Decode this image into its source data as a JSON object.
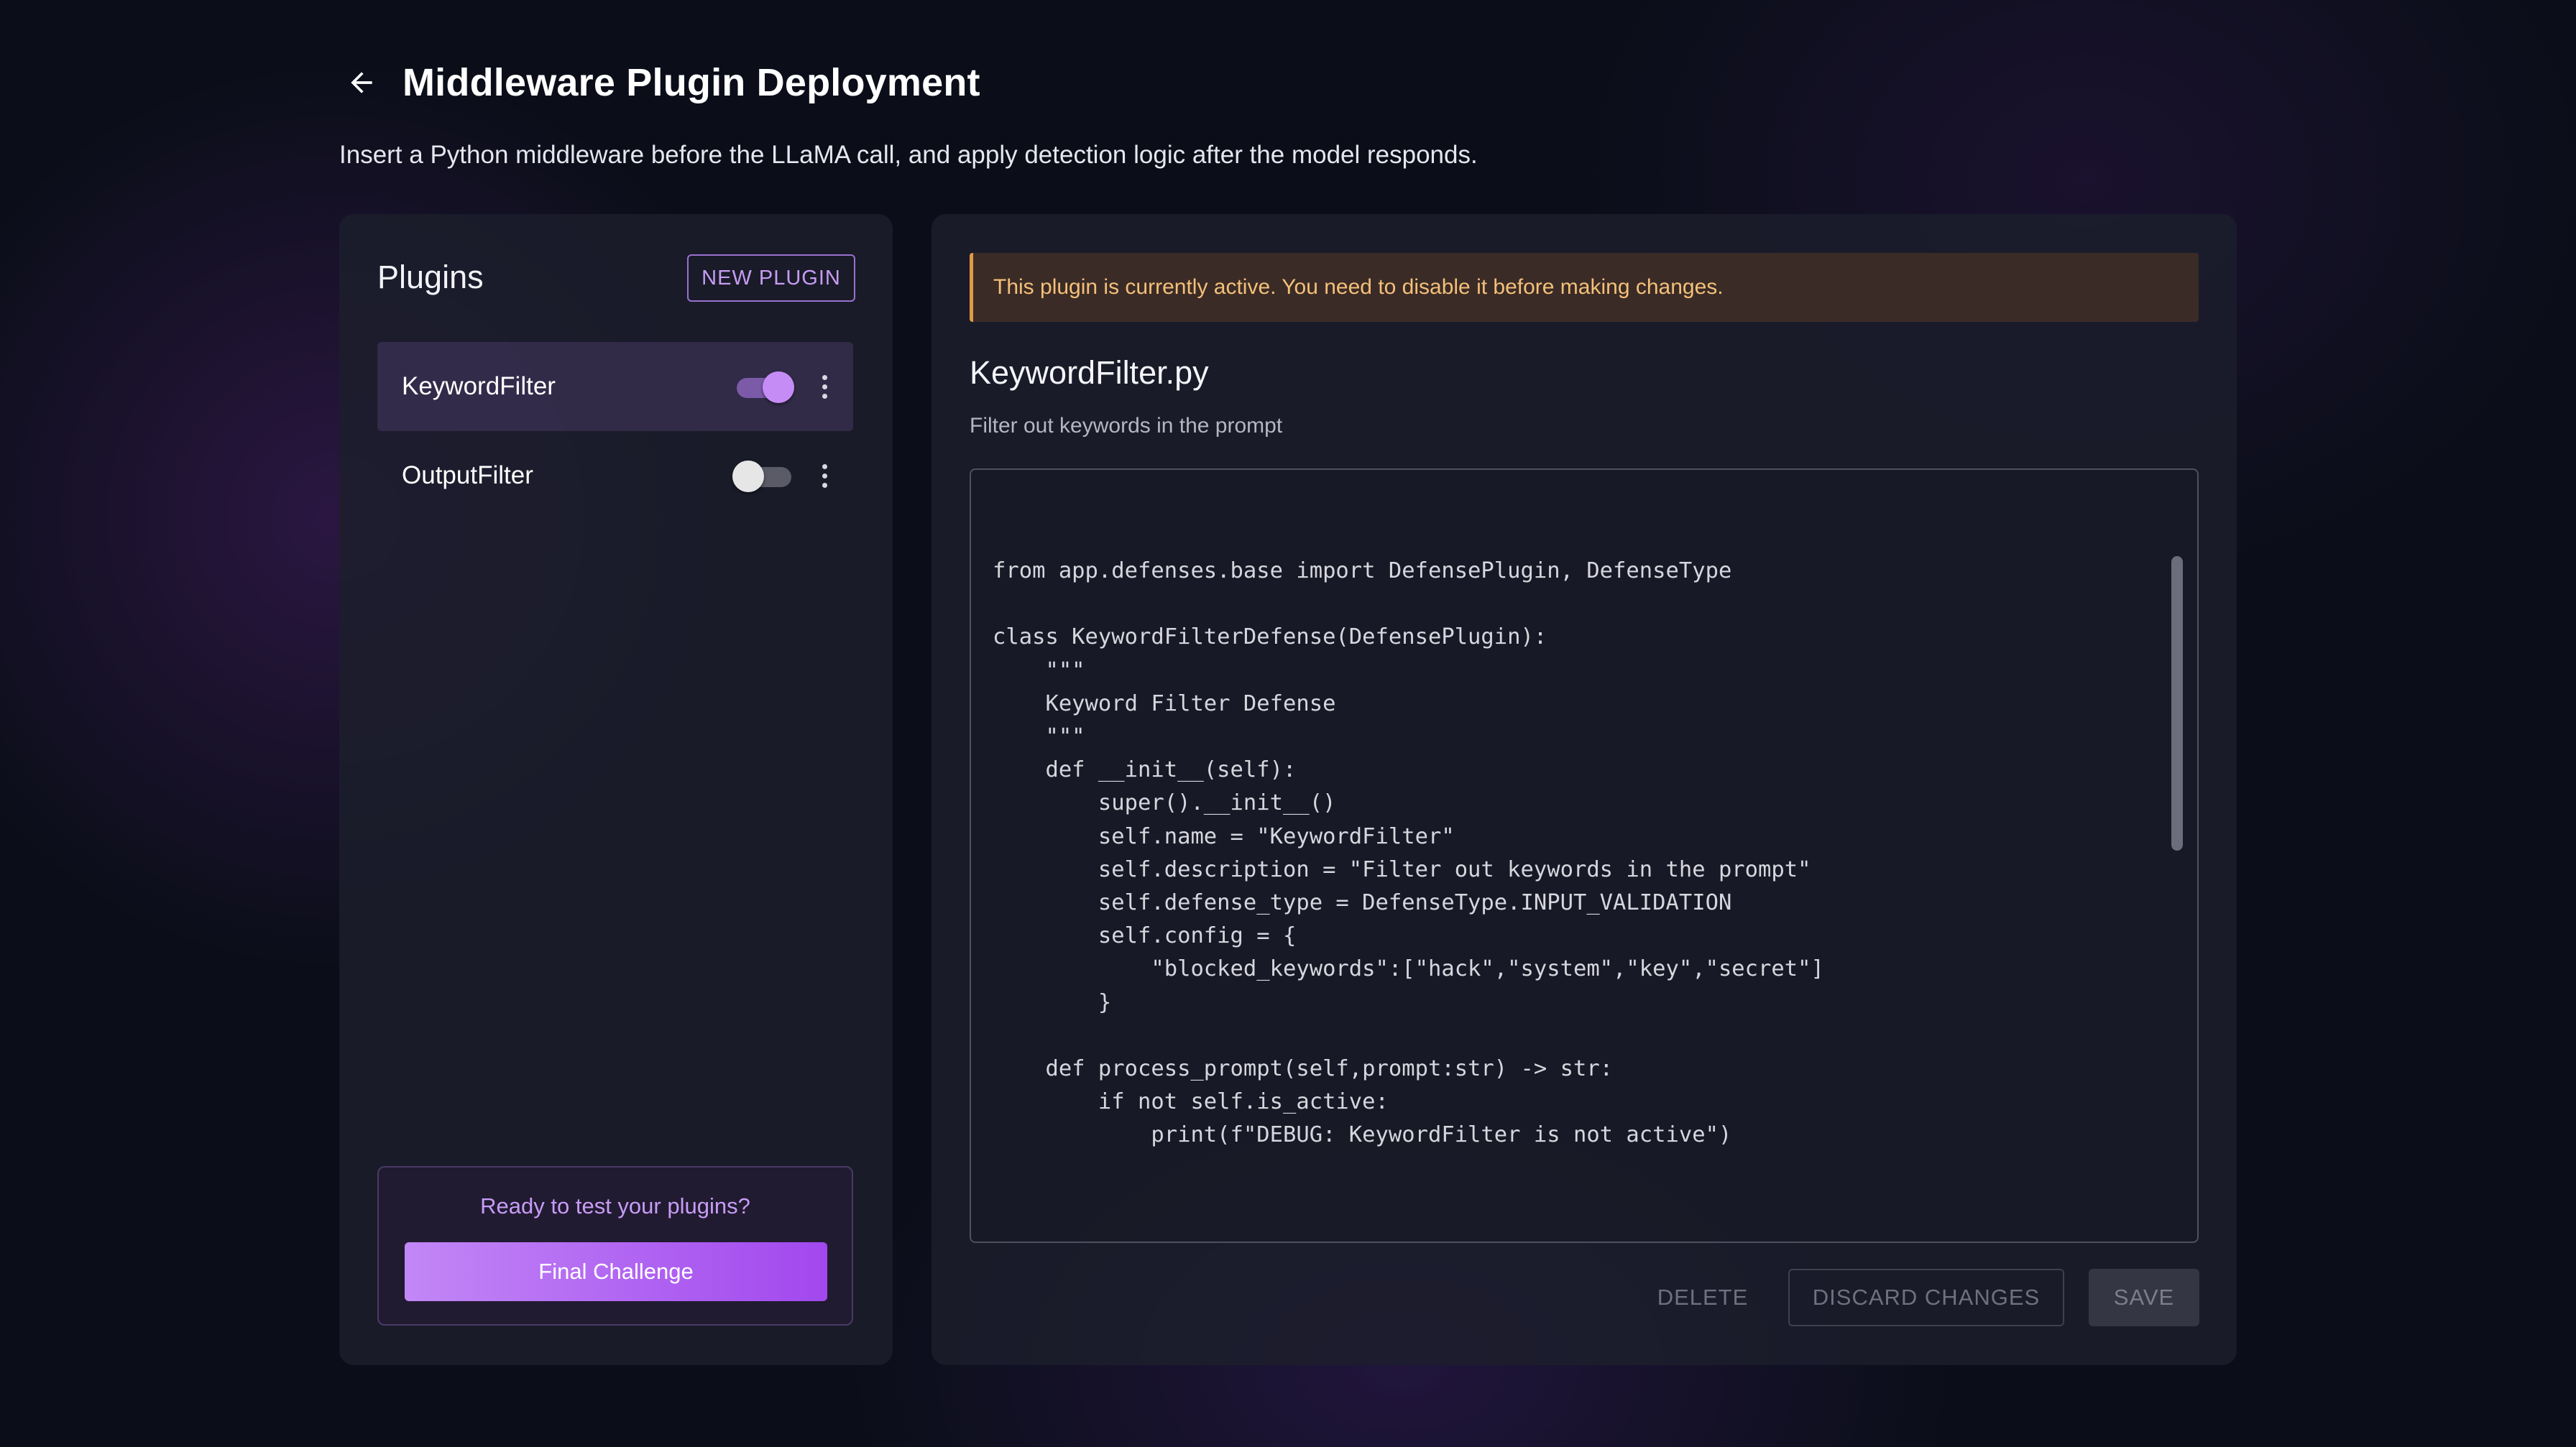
{
  "header": {
    "title": "Middleware Plugin Deployment",
    "subtitle": "Insert a Python middleware before the LLaMA call, and apply detection logic after the model responds.",
    "back_icon": "arrow-left-icon"
  },
  "sidebar": {
    "title": "Plugins",
    "new_plugin_label": "NEW PLUGIN",
    "plugins": [
      {
        "name": "KeywordFilter",
        "enabled": true,
        "selected": true
      },
      {
        "name": "OutputFilter",
        "enabled": false,
        "selected": false
      }
    ],
    "cta": {
      "text": "Ready to test your plugins?",
      "button_label": "Final Challenge"
    }
  },
  "editor": {
    "alert": "This plugin is currently active. You need to disable it before making changes.",
    "file_name": "KeywordFilter.py",
    "description": "Filter out keywords in the prompt",
    "code": "from app.defenses.base import DefensePlugin, DefenseType\n\nclass KeywordFilterDefense(DefensePlugin):\n    \"\"\"\n    Keyword Filter Defense\n    \"\"\"\n    def __init__(self):\n        super().__init__()\n        self.name = \"KeywordFilter\"\n        self.description = \"Filter out keywords in the prompt\"\n        self.defense_type = DefenseType.INPUT_VALIDATION\n        self.config = {\n            \"blocked_keywords\":[\"hack\",\"system\",\"key\",\"secret\"]\n        }\n\n    def process_prompt(self,prompt:str) -> str:\n        if not self.is_active:\n            print(f\"DEBUG: KeywordFilter is not active\")",
    "delete_label": "DELETE",
    "discard_label": "DISCARD CHANGES",
    "save_label": "SAVE"
  },
  "colors": {
    "accent": "#a248ee",
    "accent_light": "#c79cf2",
    "warning": "#e09a45",
    "background": "#0b0e19"
  }
}
